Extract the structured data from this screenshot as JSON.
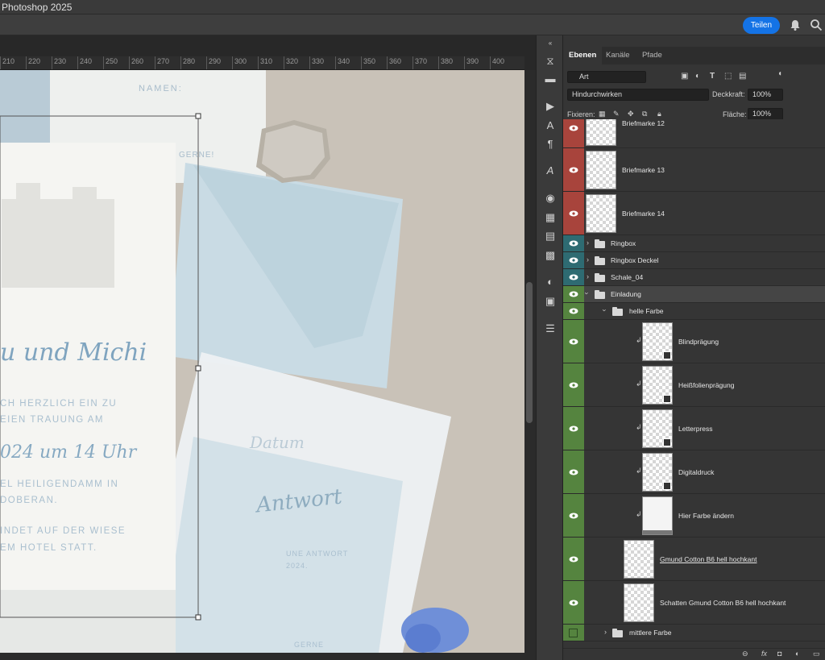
{
  "window": {
    "title": "Photoshop 2025"
  },
  "header": {
    "share_label": "Teilen"
  },
  "ruler": {
    "ticks": [
      "210",
      "220",
      "230",
      "240",
      "250",
      "260",
      "270",
      "280",
      "290",
      "300",
      "310",
      "320",
      "330",
      "340",
      "350",
      "360",
      "370",
      "380",
      "390",
      "400"
    ]
  },
  "canvas": {
    "card_line1": "u und Michi",
    "card_line2": "CH HERZLICH EIN ZU",
    "card_line3": "EIEN TRAUUNG AM",
    "card_line4": "024 um 14 Uhr",
    "card_line5": "EL HEILIGENDAMM IN",
    "card_line6": "DOBERAN.",
    "card_line7": "INDET AUF DER WIESE",
    "card_line8": "EM HOTEL STATT.",
    "names_label": "NAMEN:",
    "gerne_label": "GERNE!",
    "antwort": "Antwort",
    "antwort_sub": "UNE ANTWORT",
    "antwort_year": "2024.",
    "gerne2": "GERNE",
    "datum": "Datum"
  },
  "panel": {
    "tabs": [
      "Ebenen",
      "Kanäle",
      "Pfade"
    ],
    "filter_value": "Art",
    "blend_mode": "Hindurchwirken",
    "opacity_label": "Deckkraft:",
    "opacity_value": "100%",
    "lock_label": "Fixieren:",
    "fill_label": "Fläche:",
    "fill_value": "100%"
  },
  "layers": [
    {
      "name": "Briefmarke 12",
      "color": "#a8443c"
    },
    {
      "name": "Briefmarke 13",
      "color": "#a8443c"
    },
    {
      "name": "Briefmarke 14",
      "color": "#a8443c"
    },
    {
      "name": "Ringbox",
      "color": "#2e6b72"
    },
    {
      "name": "Ringbox Deckel",
      "color": "#2e6b72"
    },
    {
      "name": "Schale_04",
      "color": "#2e6b72"
    },
    {
      "name": "Einladung",
      "color": "#55843f"
    },
    {
      "name": "helle Farbe",
      "color": "#55843f"
    },
    {
      "name": "Blindprägung",
      "color": "#55843f"
    },
    {
      "name": "Heißfolienprägung",
      "color": "#55843f"
    },
    {
      "name": "Letterpress",
      "color": "#55843f"
    },
    {
      "name": "Digitaldruck",
      "color": "#55843f"
    },
    {
      "name": "Hier Farbe ändern",
      "color": "#55843f"
    },
    {
      "name": "Gmund Cotton B6 hell hochkant",
      "color": "#55843f"
    },
    {
      "name": "Schatten Gmund Cotton B6 hell hochkant",
      "color": "#55843f"
    },
    {
      "name": "mittlere Farbe",
      "color": "#55843f"
    }
  ],
  "bottom_bar": {
    "fx_label": "fx"
  }
}
